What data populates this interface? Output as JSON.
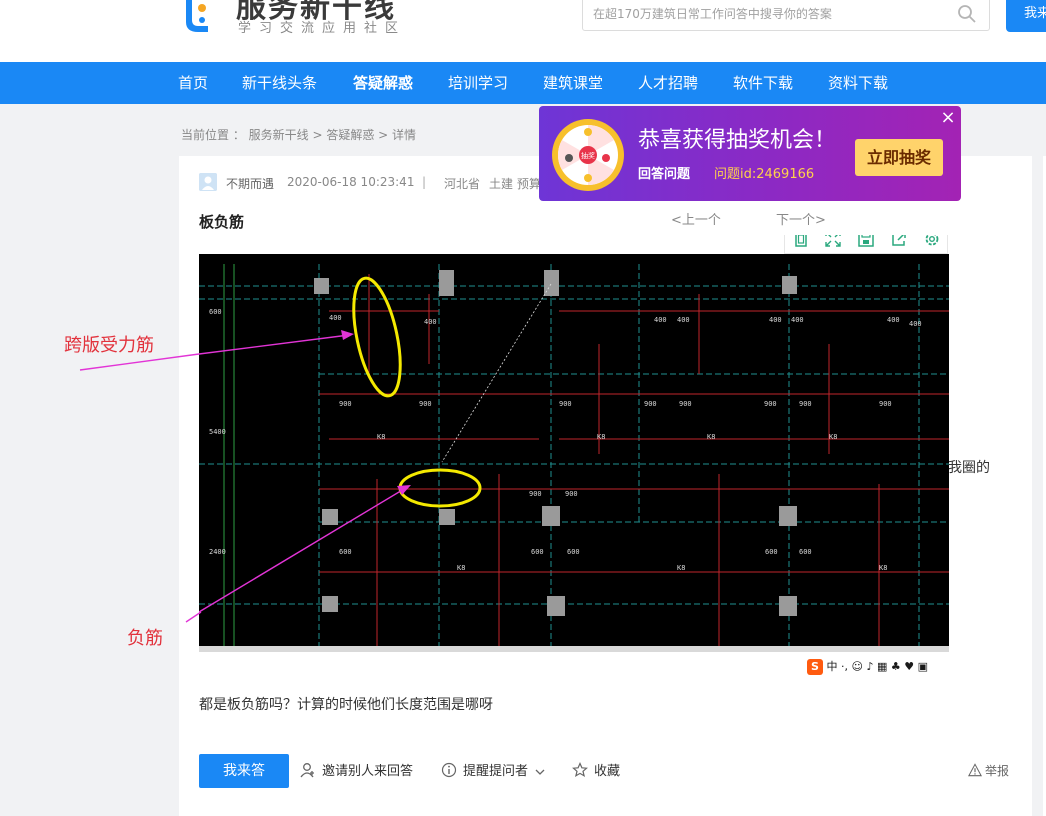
{
  "header": {
    "logo_text": "服务新干线",
    "logo_sub": "学习交流应用社区",
    "search_placeholder": "在超170万建筑日常工作问答中搜寻你的答案",
    "ask_button": "我来",
    "brand_color": "#1a88f5"
  },
  "nav": {
    "items": [
      {
        "label": "首页"
      },
      {
        "label": "新干线头条"
      },
      {
        "label": "答疑解惑"
      },
      {
        "label": "培训学习"
      },
      {
        "label": "建筑课堂"
      },
      {
        "label": "人才招聘"
      },
      {
        "label": "软件下载"
      },
      {
        "label": "资料下载"
      }
    ],
    "active_index": 2
  },
  "breadcrumb": "当前位置 ： 服务新干线 > 答疑解惑 > 详情",
  "question": {
    "author": "不期而遇",
    "time": "2020-06-18 10:23:41",
    "separator": "|",
    "location": "河北省",
    "tags": "土建 预算",
    "title": "板负筋",
    "body": "都是板负筋吗？计算的时候他们长度范围是哪呀",
    "overflow_text": "我圈的"
  },
  "image": {
    "annotation_1": "跨版受力筋",
    "annotation_2": "负筋",
    "ime_logo": "S",
    "ime_text": "中 ·, ☺ ♪ ▦ ♣ ♥ ▣"
  },
  "image_tools": [
    "copy-icon",
    "expand-icon",
    "save-icon",
    "share-icon",
    "settings-icon"
  ],
  "promo": {
    "title": "恭喜获得抽奖机会！",
    "sub1": "回答问题",
    "sub2": "问题id:2469166",
    "button": "立即抽奖",
    "close": "×",
    "prev": "<上一个",
    "next": "下一个>"
  },
  "actions": {
    "answer": "我来答",
    "invite": "邀请别人来回答",
    "remind": "提醒提问者",
    "favorite": "收藏",
    "report": "举报"
  }
}
